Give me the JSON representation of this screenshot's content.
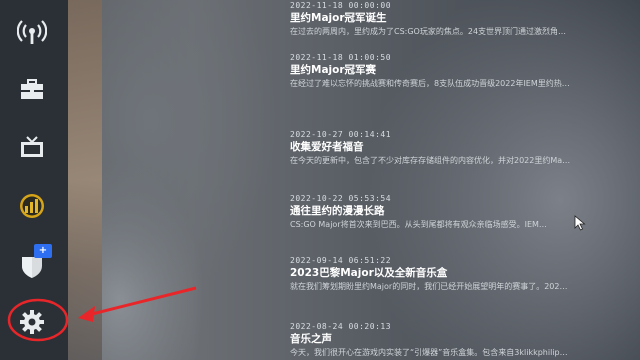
{
  "sidebar": {
    "items": [
      {
        "icon": "broadcast-icon"
      },
      {
        "icon": "briefcase-icon"
      },
      {
        "icon": "tv-icon"
      },
      {
        "icon": "rank-icon"
      },
      {
        "icon": "shield-icon",
        "badge": "+"
      },
      {
        "icon": "gear-icon"
      }
    ]
  },
  "news": [
    {
      "date": "2022-11-18 00:00:00",
      "title": "里约Major冠军诞生",
      "summary": "在过去的两周内，里约成为了CS:GO玩家的焦点。24支世界顶门通过激烈角…"
    },
    {
      "date": "2022-11-18 01:00:50",
      "title": "里约Major冠军赛",
      "summary": "在经过了难以忘怀的挑战赛和传奇赛后，8支队伍成功晋级2022年IEM里约热…"
    },
    {
      "date": "2022-10-27 00:14:41",
      "title": "收集爱好者福音",
      "summary": "在今天的更新中，包含了不少对库存存储组件的内容优化，并对2022里约Ma…"
    },
    {
      "date": "2022-10-22 05:53:54",
      "title": "通往里约的漫漫长路",
      "summary": "CS:GO Major将首次来到巴西。从头到尾都将有观众亲临场感受。IEM…"
    },
    {
      "date": "2022-09-14 06:51:22",
      "title": "2023巴黎Major以及全新音乐盒",
      "summary": "就在我们筹划期盼里约Major的同时，我们已经开始展望明年的赛事了。202…"
    },
    {
      "date": "2022-08-24 00:20:13",
      "title": "音乐之声",
      "summary": "今天，我们很开心在游戏内实装了“引爆器”音乐盒集。包含来自3klikkphilip…"
    }
  ],
  "colors": {
    "annotation": "#e8262a",
    "badge": "#2d6ff0"
  }
}
